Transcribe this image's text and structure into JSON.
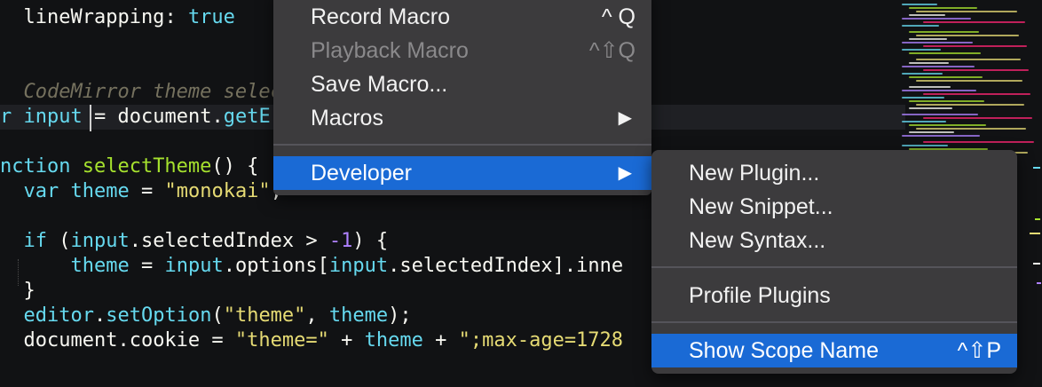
{
  "code_lines": [
    {
      "tokens": [
        {
          "t": "  lineWrapping",
          "c": "tok-obj"
        },
        {
          "t": ": ",
          "c": "tok-obj"
        },
        {
          "t": "true",
          "c": "tok-kw"
        }
      ]
    },
    {
      "tokens": []
    },
    {
      "tokens": []
    },
    {
      "tokens": [
        {
          "t": "  CodeMirror theme selec",
          "c": "tok-com"
        }
      ]
    },
    {
      "tokens": [
        {
          "t": "r ",
          "c": "tok-kw"
        },
        {
          "t": "input",
          "c": "tok-var"
        },
        {
          "t": " = ",
          "c": "tok-obj"
        },
        {
          "t": "document",
          "c": "tok-obj"
        },
        {
          "t": ".",
          "c": "tok-obj"
        },
        {
          "t": "getE",
          "c": "tok-prop"
        }
      ]
    },
    {
      "tokens": []
    },
    {
      "tokens": [
        {
          "t": "nction ",
          "c": "tok-kw"
        },
        {
          "t": "selectTheme",
          "c": "tok-fn"
        },
        {
          "t": "() {",
          "c": "tok-obj"
        }
      ]
    },
    {
      "tokens": [
        {
          "t": "  ",
          "c": "tok-obj"
        },
        {
          "t": "var ",
          "c": "tok-kw"
        },
        {
          "t": "theme",
          "c": "tok-var"
        },
        {
          "t": " = ",
          "c": "tok-obj"
        },
        {
          "t": "\"monokai\"",
          "c": "tok-str"
        },
        {
          "t": ";",
          "c": "tok-obj"
        }
      ]
    },
    {
      "tokens": []
    },
    {
      "tokens": [
        {
          "t": "  ",
          "c": "tok-obj"
        },
        {
          "t": "if",
          "c": "tok-kw"
        },
        {
          "t": " (",
          "c": "tok-obj"
        },
        {
          "t": "input",
          "c": "tok-var"
        },
        {
          "t": ".selectedIndex > ",
          "c": "tok-obj"
        },
        {
          "t": "-1",
          "c": "tok-num"
        },
        {
          "t": ") {",
          "c": "tok-obj"
        }
      ]
    },
    {
      "tokens": [
        {
          "t": "      ",
          "c": "tok-obj"
        },
        {
          "t": "theme",
          "c": "tok-var"
        },
        {
          "t": " = ",
          "c": "tok-obj"
        },
        {
          "t": "input",
          "c": "tok-var"
        },
        {
          "t": ".options[",
          "c": "tok-obj"
        },
        {
          "t": "input",
          "c": "tok-var"
        },
        {
          "t": ".selectedIndex].inne",
          "c": "tok-obj"
        }
      ]
    },
    {
      "tokens": [
        {
          "t": "  }",
          "c": "tok-obj"
        }
      ]
    },
    {
      "tokens": [
        {
          "t": "  ",
          "c": "tok-obj"
        },
        {
          "t": "editor",
          "c": "tok-var"
        },
        {
          "t": ".",
          "c": "tok-obj"
        },
        {
          "t": "setOption",
          "c": "tok-prop"
        },
        {
          "t": "(",
          "c": "tok-obj"
        },
        {
          "t": "\"theme\"",
          "c": "tok-str"
        },
        {
          "t": ", ",
          "c": "tok-obj"
        },
        {
          "t": "theme",
          "c": "tok-var"
        },
        {
          "t": ");",
          "c": "tok-obj"
        }
      ]
    },
    {
      "tokens": [
        {
          "t": "  document",
          "c": "tok-obj"
        },
        {
          "t": ".cookie = ",
          "c": "tok-obj"
        },
        {
          "t": "\"theme=\"",
          "c": "tok-str"
        },
        {
          "t": " + ",
          "c": "tok-obj"
        },
        {
          "t": "theme",
          "c": "tok-var"
        },
        {
          "t": " + ",
          "c": "tok-obj"
        },
        {
          "t": "\";max-age=1728",
          "c": "tok-str"
        }
      ]
    }
  ],
  "menu": {
    "items": [
      {
        "label": "Record Macro",
        "shortcut": "^ Q",
        "state": "normal"
      },
      {
        "label": "Playback Macro",
        "shortcut": "^⇧Q",
        "state": "disabled"
      },
      {
        "label": "Save Macro...",
        "shortcut": "",
        "state": "normal"
      },
      {
        "label": "Macros",
        "submenu_arrow": "▶",
        "state": "normal"
      },
      {
        "label": "Developer",
        "submenu_arrow": "▶",
        "state": "highlighted"
      }
    ]
  },
  "submenu": {
    "items": [
      {
        "label": "New Plugin...",
        "shortcut": "",
        "state": "normal"
      },
      {
        "label": "New Snippet...",
        "shortcut": "",
        "state": "normal"
      },
      {
        "label": "New Syntax...",
        "shortcut": "",
        "state": "normal"
      },
      {
        "label": "Profile Plugins",
        "shortcut": "",
        "state": "normal"
      },
      {
        "label": "Show Scope Name",
        "shortcut": "^⇧P",
        "state": "highlighted"
      }
    ]
  },
  "colors": {
    "menu_bg": "#3c3b3d",
    "highlight": "#1a6ad5",
    "editor_bg": "#111214"
  }
}
